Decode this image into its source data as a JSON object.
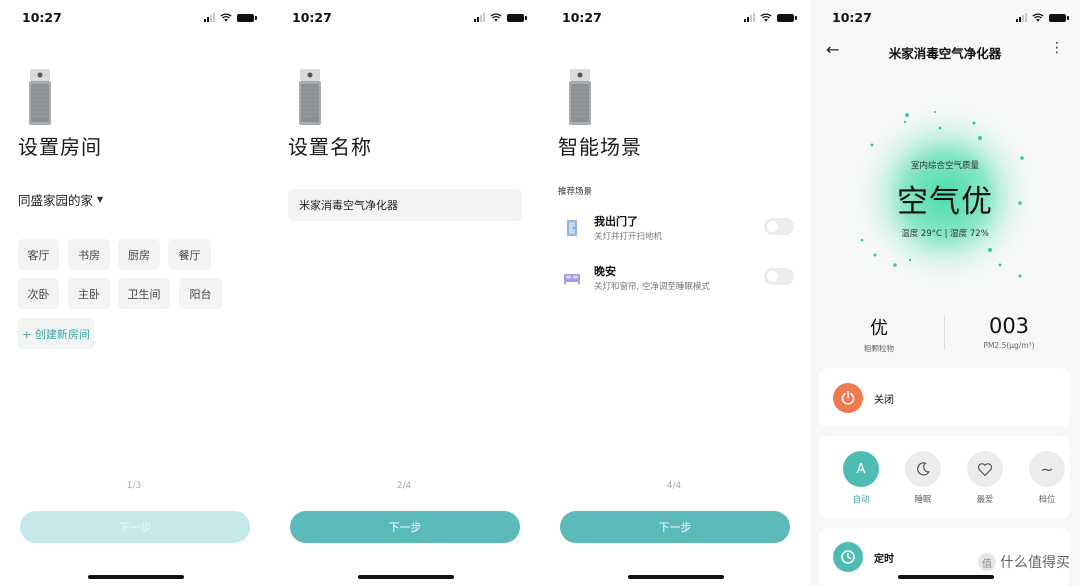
{
  "status": {
    "s1_time": "10:27",
    "s2_time": "10:27",
    "s3_time": "10:27",
    "s4_time": "10:27"
  },
  "screen1": {
    "title": "设置房间",
    "home": "同盛家园的家",
    "rooms": [
      "客厅",
      "书房",
      "厨房",
      "餐厅",
      "次卧",
      "主卧",
      "卫生间",
      "阳台"
    ],
    "add_room": "+ 创建新房间",
    "pager": "1/3",
    "next": "下一步"
  },
  "screen2": {
    "title": "设置名称",
    "name_value": "米家消毒空气净化器",
    "pager": "2/4",
    "next": "下一步"
  },
  "screen3": {
    "title": "智能场景",
    "section": "推荐场景",
    "scenes": [
      {
        "title": "我出门了",
        "desc": "关灯并打开扫地机",
        "icon": "door-icon",
        "enabled": false
      },
      {
        "title": "晚安",
        "desc": "关灯和窗帘, 空净调至睡眠模式",
        "icon": "bed-icon",
        "enabled": false
      }
    ],
    "pager": "4/4",
    "next": "下一步"
  },
  "screen4": {
    "title": "米家消毒空气净化器",
    "aq_label": "室内综合空气质量",
    "aq_value": "空气优",
    "temp_humidity": "温度 29°C | 湿度 72%",
    "metric_left_value": "优",
    "metric_left_label": "粗颗粒物",
    "metric_right_value": "003",
    "metric_right_label": "PM2.5(μg/m³)",
    "power_label": "关闭",
    "modes": [
      {
        "label": "自动",
        "glyph": "A",
        "active": true
      },
      {
        "label": "睡眠",
        "glyph": "",
        "active": false
      },
      {
        "label": "最爱",
        "glyph": "",
        "active": false
      },
      {
        "label": "档位",
        "glyph": "~",
        "active": false
      }
    ],
    "timer_label": "定时",
    "colors": {
      "accent": "#4dbdb4",
      "power": "#ee7b50"
    }
  },
  "watermark": "什么值得买"
}
